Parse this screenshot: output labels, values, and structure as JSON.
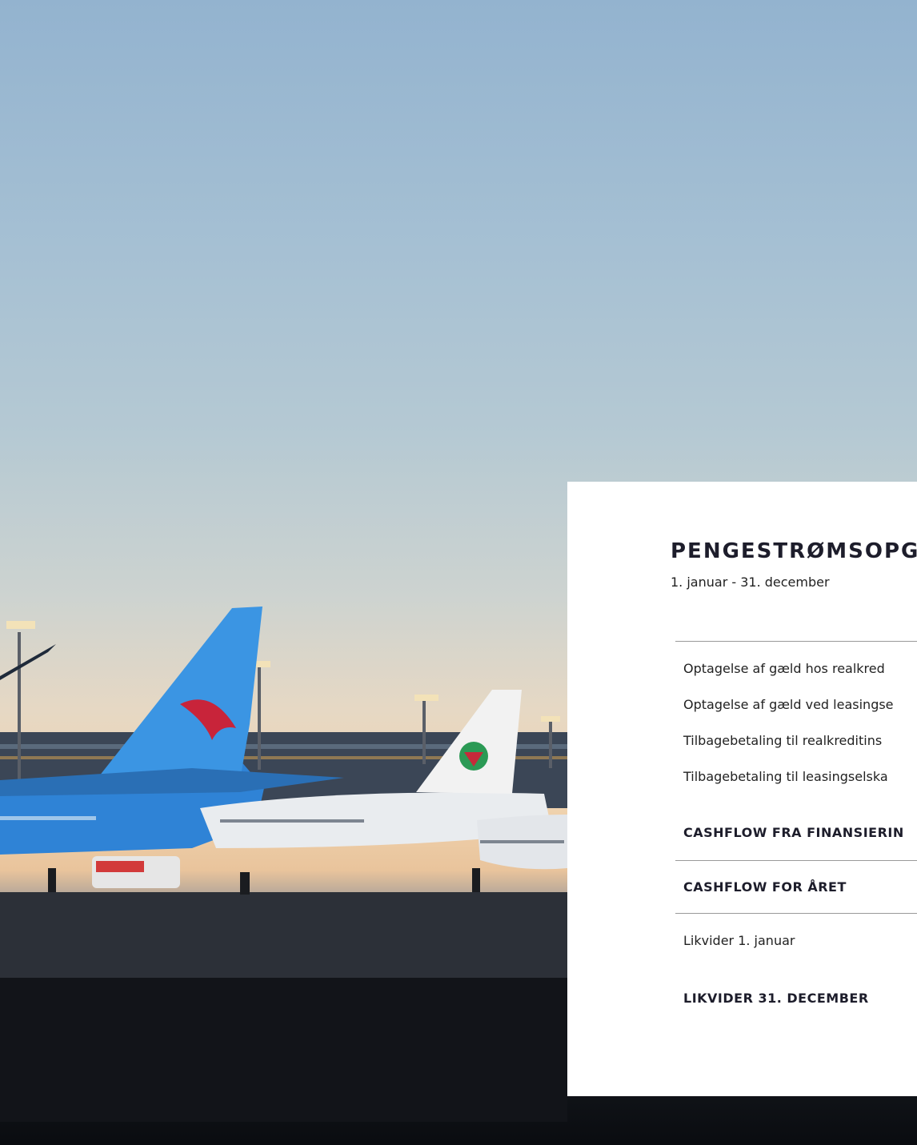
{
  "statement": {
    "title": "PENGESTRØMSOPGØ",
    "subtitle": "1. januar - 31. december",
    "rows": [
      "Optagelse af gæld hos realkred",
      "Optagelse af gæld ved leasingse",
      "Tilbagebetaling til realkreditins",
      "Tilbagebetaling til leasingselska",
      "CASHFLOW FRA FINANSIERIN",
      "CASHFLOW FOR ÅRET",
      "Likvider 1. januar",
      "LIKVIDER 31. DECEMBER"
    ]
  }
}
